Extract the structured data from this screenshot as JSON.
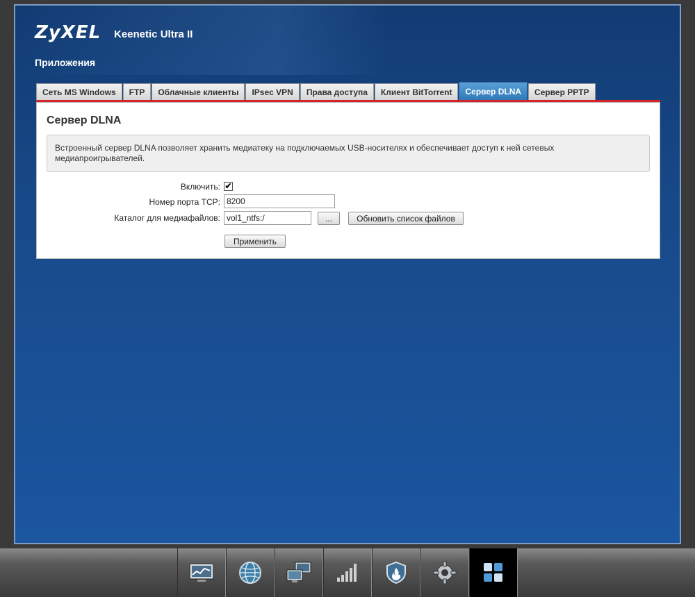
{
  "header": {
    "brand": "ZyXEL",
    "model": "Keenetic Ultra II",
    "section": "Приложения"
  },
  "tabs": [
    {
      "label": "Сеть MS Windows",
      "active": false
    },
    {
      "label": "FTP",
      "active": false
    },
    {
      "label": "Облачные клиенты",
      "active": false
    },
    {
      "label": "IPsec VPN",
      "active": false
    },
    {
      "label": "Права доступа",
      "active": false
    },
    {
      "label": "Клиент BitTorrent",
      "active": false
    },
    {
      "label": "Сервер DLNA",
      "active": true
    },
    {
      "label": "Сервер PPTP",
      "active": false
    }
  ],
  "panel": {
    "title": "Сервер DLNA",
    "description": "Встроенный сервер DLNA позволяет хранить медиатеку на подключаемых USB-носителях и обеспечивает доступ к ней сетевых медиапроигрывателей.",
    "enable_label": "Включить:",
    "enable_checked": true,
    "enable_mark": "✔",
    "port_label": "Номер порта TCP:",
    "port_value": "8200",
    "dir_label": "Каталог для медиафайлов:",
    "dir_value": "vol1_ntfs:/",
    "browse_label": "...",
    "refresh_label": "Обновить список файлов",
    "apply_label": "Применить"
  },
  "taskbar": [
    {
      "icon": "monitor-chart-icon",
      "active": false
    },
    {
      "icon": "globe-icon",
      "active": false
    },
    {
      "icon": "network-computers-icon",
      "active": false
    },
    {
      "icon": "signal-bars-icon",
      "active": false
    },
    {
      "icon": "shield-flame-icon",
      "active": false
    },
    {
      "icon": "gear-icon",
      "active": false
    },
    {
      "icon": "apps-grid-icon",
      "active": true
    }
  ],
  "colors": {
    "background": "#1b56a0",
    "tab_active": "#2f79b8",
    "accent_line": "#d4232b"
  }
}
